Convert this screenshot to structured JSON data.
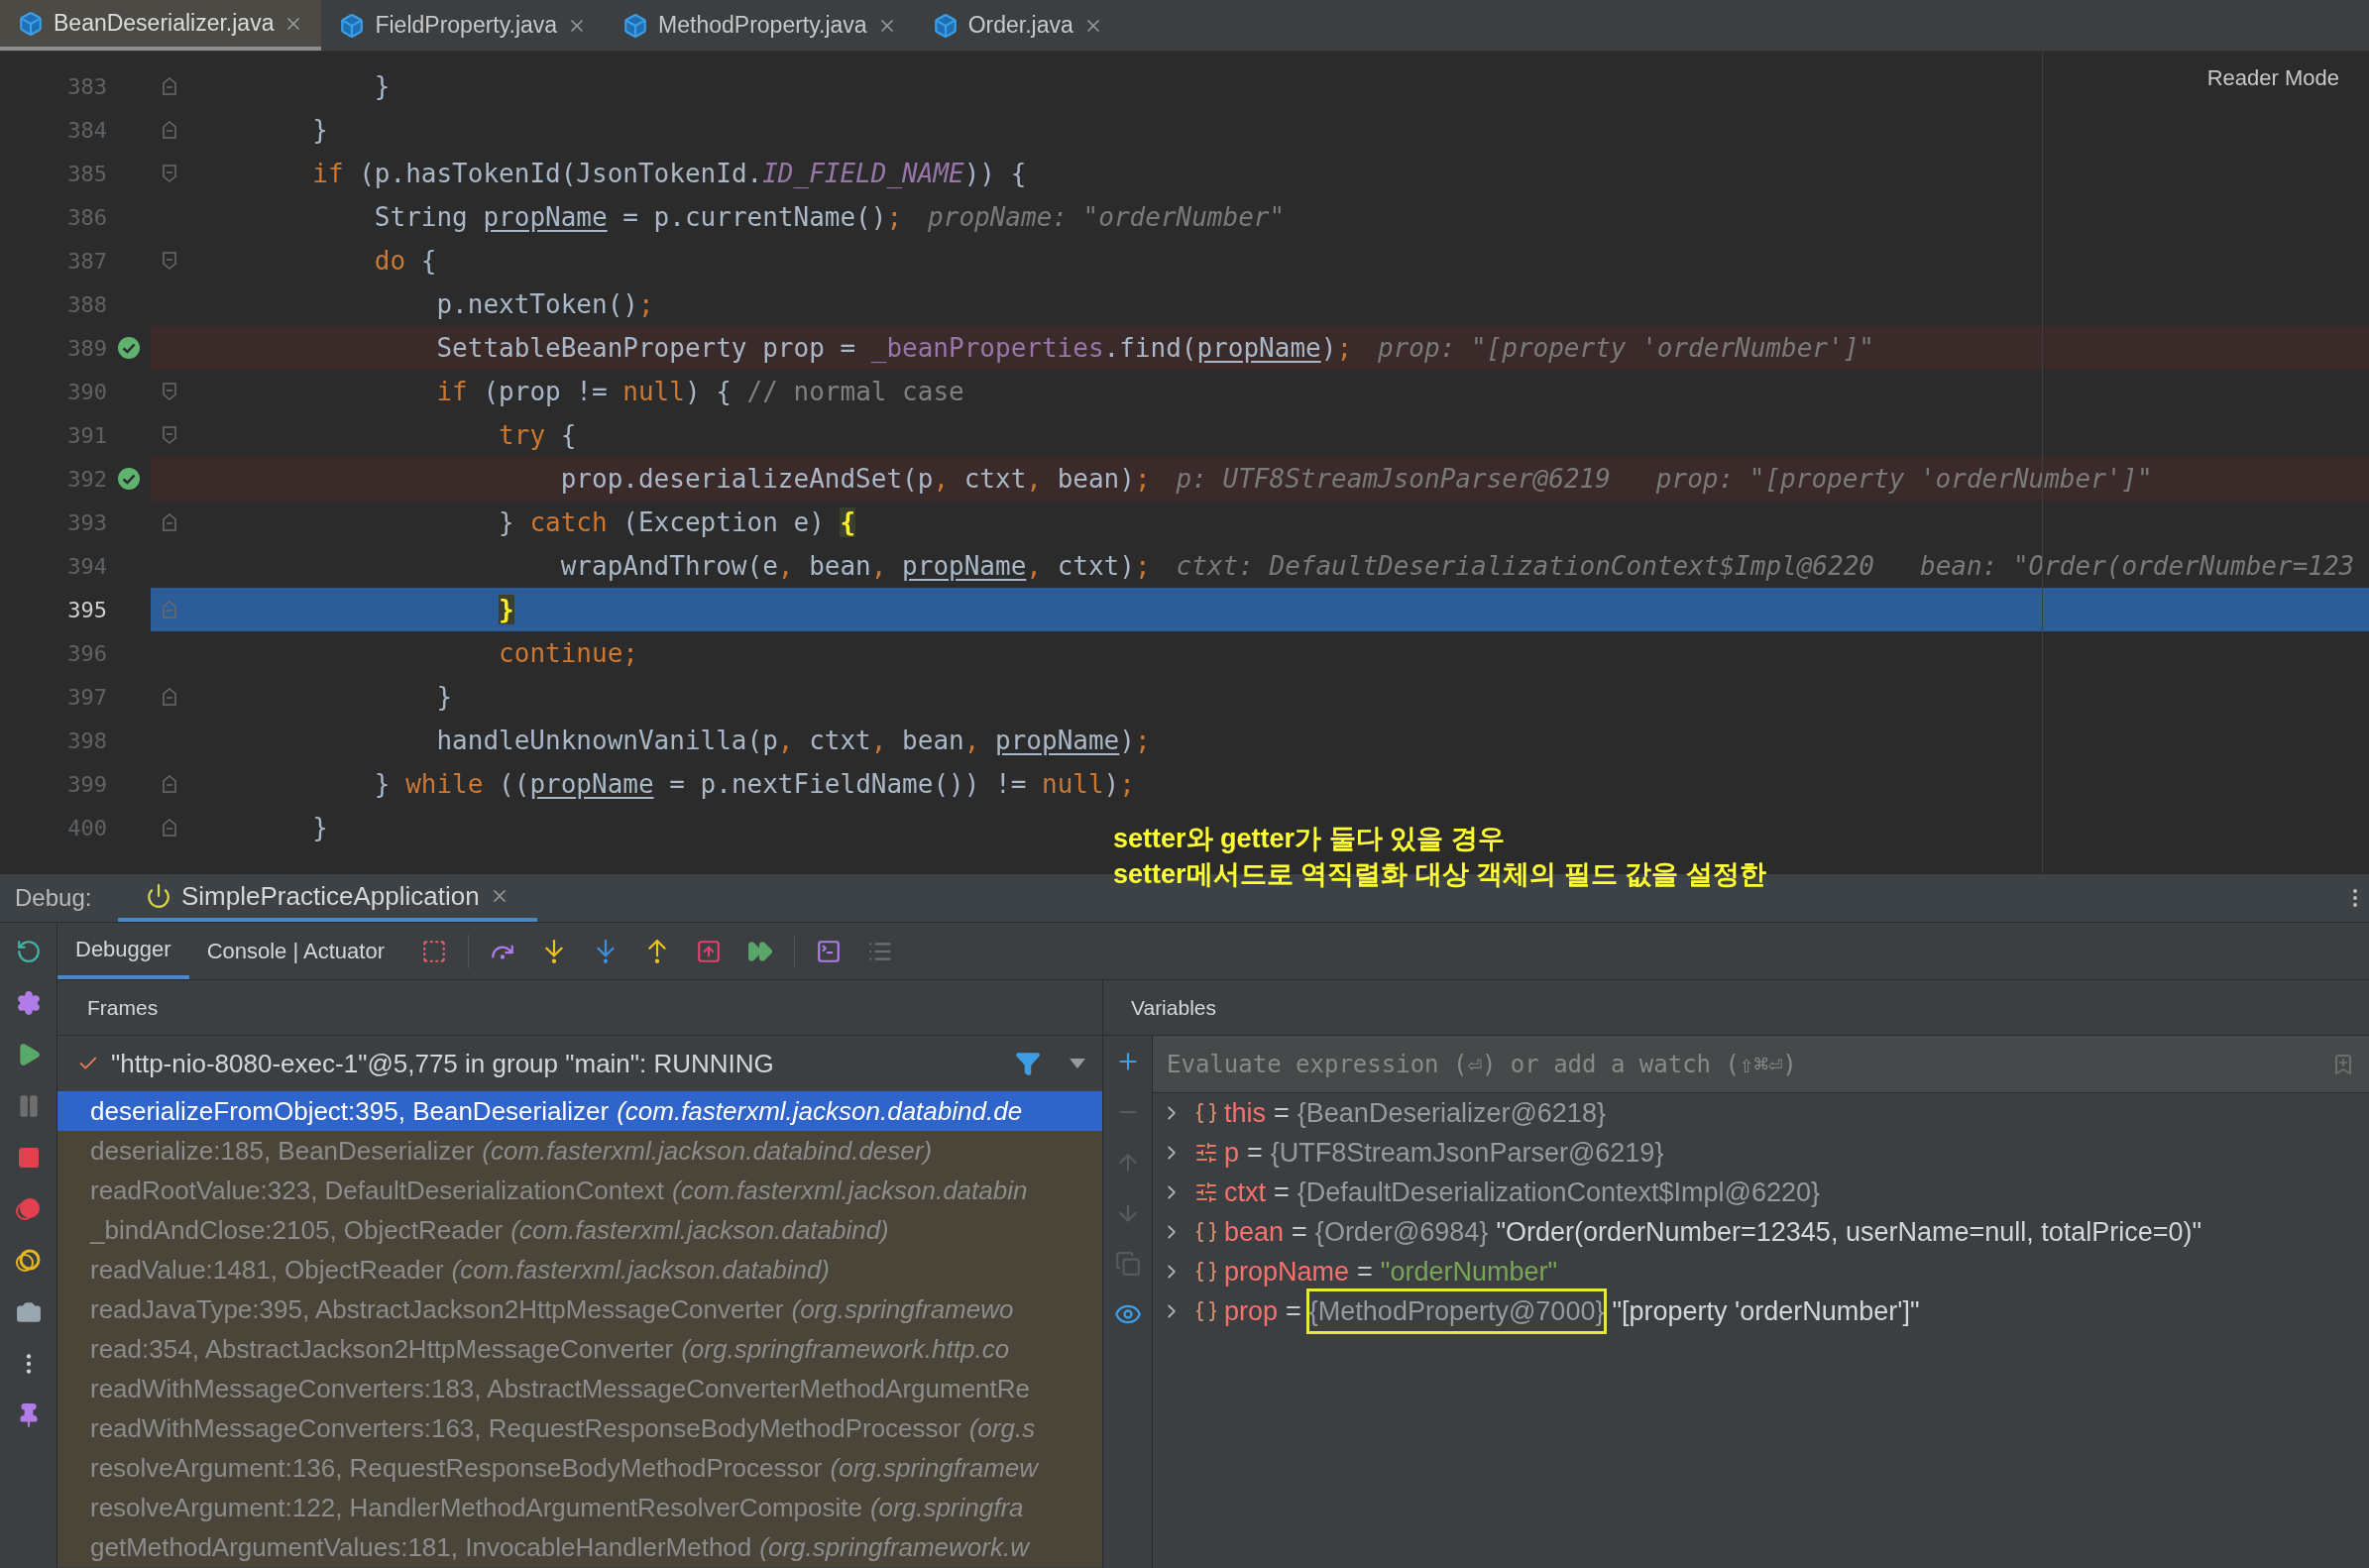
{
  "tabs": [
    {
      "label": "BeanDeserializer.java",
      "selected": true
    },
    {
      "label": "FieldProperty.java",
      "selected": false
    },
    {
      "label": "MethodProperty.java",
      "selected": false
    },
    {
      "label": "Order.java",
      "selected": false
    }
  ],
  "editor": {
    "reader_mode": "Reader Mode",
    "lines": [
      {
        "number": "383",
        "fold_open": false,
        "fold_close": true,
        "breakpoint": false,
        "current": false,
        "tokens": [
          {
            "text": "            }",
            "kind": "plain"
          }
        ]
      },
      {
        "number": "384",
        "fold_open": false,
        "fold_close": true,
        "breakpoint": false,
        "current": false,
        "tokens": [
          {
            "text": "        }",
            "kind": "plain"
          }
        ]
      },
      {
        "number": "385",
        "fold_open": true,
        "fold_close": false,
        "breakpoint": false,
        "current": false,
        "tokens": [
          {
            "text": "        if",
            "kind": "keyword"
          },
          {
            "text": " (p.hasTokenId(JsonTokenId.",
            "kind": "plain"
          },
          {
            "text": "ID_FIELD_NAME",
            "kind": "static"
          },
          {
            "text": ")) {",
            "kind": "plain"
          }
        ]
      },
      {
        "number": "386",
        "fold_open": false,
        "fold_close": false,
        "breakpoint": false,
        "current": false,
        "tokens": [
          {
            "text": "            String ",
            "kind": "plain"
          },
          {
            "text": "propName",
            "kind": "ref"
          },
          {
            "text": " = p.currentName()",
            "kind": "plain"
          },
          {
            "text": ";",
            "kind": "keyword"
          }
        ],
        "hints": [
          "propName: \"orderNumber\""
        ]
      },
      {
        "number": "387",
        "fold_open": true,
        "fold_close": false,
        "breakpoint": false,
        "current": false,
        "tokens": [
          {
            "text": "            do",
            "kind": "keyword"
          },
          {
            "text": " {",
            "kind": "plain"
          }
        ]
      },
      {
        "number": "388",
        "fold_open": false,
        "fold_close": false,
        "breakpoint": false,
        "current": false,
        "tokens": [
          {
            "text": "                p.nextToken()",
            "kind": "plain"
          },
          {
            "text": ";",
            "kind": "keyword"
          }
        ]
      },
      {
        "number": "389",
        "fold_open": false,
        "fold_close": false,
        "breakpoint": true,
        "current": false,
        "tokens": [
          {
            "text": "                SettableBeanProperty prop = ",
            "kind": "plain"
          },
          {
            "text": "_beanProperties",
            "kind": "field"
          },
          {
            "text": ".find(",
            "kind": "plain"
          },
          {
            "text": "propName",
            "kind": "ref"
          },
          {
            "text": ")",
            "kind": "plain"
          },
          {
            "text": ";",
            "kind": "keyword"
          }
        ],
        "hints": [
          "prop: \"[property 'orderNumber']\""
        ]
      },
      {
        "number": "390",
        "fold_open": true,
        "fold_close": false,
        "breakpoint": false,
        "current": false,
        "tokens": [
          {
            "text": "                if",
            "kind": "keyword"
          },
          {
            "text": " (prop != ",
            "kind": "plain"
          },
          {
            "text": "null",
            "kind": "keyword"
          },
          {
            "text": ") { ",
            "kind": "plain"
          },
          {
            "text": "// normal case",
            "kind": "comment"
          }
        ]
      },
      {
        "number": "391",
        "fold_open": true,
        "fold_close": false,
        "breakpoint": false,
        "current": false,
        "tokens": [
          {
            "text": "                    try",
            "kind": "keyword"
          },
          {
            "text": " {",
            "kind": "plain"
          }
        ]
      },
      {
        "number": "392",
        "fold_open": false,
        "fold_close": false,
        "breakpoint": true,
        "current": false,
        "tokens": [
          {
            "text": "                        prop.deserializeAndSet(p",
            "kind": "plain"
          },
          {
            "text": ",",
            "kind": "keyword"
          },
          {
            "text": " ctxt",
            "kind": "plain"
          },
          {
            "text": ",",
            "kind": "keyword"
          },
          {
            "text": " bean)",
            "kind": "plain"
          },
          {
            "text": ";",
            "kind": "keyword"
          }
        ],
        "hints": [
          "p: UTF8StreamJsonParser@6219",
          "prop: \"[property 'orderNumber']\""
        ]
      },
      {
        "number": "393",
        "fold_open": false,
        "fold_close": true,
        "breakpoint": false,
        "current": false,
        "tokens": [
          {
            "text": "                    } ",
            "kind": "plain"
          },
          {
            "text": "catch",
            "kind": "keyword"
          },
          {
            "text": " (Exception e) ",
            "kind": "plain"
          },
          {
            "text": "{",
            "kind": "match"
          }
        ]
      },
      {
        "number": "394",
        "fold_open": false,
        "fold_close": false,
        "breakpoint": false,
        "current": false,
        "tokens": [
          {
            "text": "                        wrapAndThrow(e",
            "kind": "plain"
          },
          {
            "text": ",",
            "kind": "keyword"
          },
          {
            "text": " bean",
            "kind": "plain"
          },
          {
            "text": ", ",
            "kind": "keyword"
          },
          {
            "text": "propName",
            "kind": "ref"
          },
          {
            "text": ",",
            "kind": "keyword"
          },
          {
            "text": " ctxt)",
            "kind": "plain"
          },
          {
            "text": ";",
            "kind": "keyword"
          }
        ],
        "hints": [
          "ctxt: DefaultDeserializationContext$Impl@6220",
          "bean: \"Order(orderNumber=123"
        ]
      },
      {
        "number": "395",
        "fold_open": false,
        "fold_close": true,
        "breakpoint": false,
        "current": true,
        "tokens": [
          {
            "text": "                    }",
            "kind": "match"
          }
        ]
      },
      {
        "number": "396",
        "fold_open": false,
        "fold_close": false,
        "breakpoint": false,
        "current": false,
        "tokens": [
          {
            "text": "                    continue;",
            "kind": "keyword"
          }
        ]
      },
      {
        "number": "397",
        "fold_open": false,
        "fold_close": true,
        "breakpoint": false,
        "current": false,
        "tokens": [
          {
            "text": "                }",
            "kind": "plain"
          }
        ]
      },
      {
        "number": "398",
        "fold_open": false,
        "fold_close": false,
        "breakpoint": false,
        "current": false,
        "tokens": [
          {
            "text": "                handleUnknownVanilla(p",
            "kind": "plain"
          },
          {
            "text": ",",
            "kind": "keyword"
          },
          {
            "text": " ctxt",
            "kind": "plain"
          },
          {
            "text": ",",
            "kind": "keyword"
          },
          {
            "text": " bean",
            "kind": "plain"
          },
          {
            "text": ", ",
            "kind": "keyword"
          },
          {
            "text": "propName",
            "kind": "ref"
          },
          {
            "text": ")",
            "kind": "plain"
          },
          {
            "text": ";",
            "kind": "keyword"
          }
        ]
      },
      {
        "number": "399",
        "fold_open": false,
        "fold_close": true,
        "breakpoint": false,
        "current": false,
        "tokens": [
          {
            "text": "            } ",
            "kind": "plain"
          },
          {
            "text": "while",
            "kind": "keyword"
          },
          {
            "text": " ((",
            "kind": "plain"
          },
          {
            "text": "propName",
            "kind": "ref"
          },
          {
            "text": " = p.nextFieldName()) != ",
            "kind": "plain"
          },
          {
            "text": "null",
            "kind": "keyword"
          },
          {
            "text": ")",
            "kind": "plain"
          },
          {
            "text": ";",
            "kind": "keyword"
          }
        ]
      },
      {
        "number": "400",
        "fold_open": false,
        "fold_close": true,
        "breakpoint": false,
        "current": false,
        "tokens": [
          {
            "text": "        }",
            "kind": "plain"
          }
        ]
      }
    ]
  },
  "annotation": [
    "setter와 getter가 둘다 있을 경우",
    "setter메서드로 역직렬화 대상 객체의 필드 값을 설정한"
  ],
  "debug": {
    "label": "Debug:",
    "session": {
      "label": "SimplePracticeApplication",
      "selected": true
    },
    "tabs": [
      {
        "label": "Debugger",
        "selected": true
      },
      {
        "label": "Console | Actuator",
        "selected": false
      }
    ],
    "frames": {
      "title": "Frames",
      "thread": "\"http-nio-8080-exec-1\"@5,775 in group \"main\": RUNNING",
      "items": [
        {
          "label": "deserializeFromObject:395, BeanDeserializer",
          "package": "(com.fasterxml.jackson.databind.de",
          "selected": true
        },
        {
          "label": "deserialize:185, BeanDeserializer",
          "package": "(com.fasterxml.jackson.databind.deser)",
          "selected": false,
          "library": true
        },
        {
          "label": "readRootValue:323, DefaultDeserializationContext",
          "package": "(com.fasterxml.jackson.databin",
          "selected": false,
          "library": true
        },
        {
          "label": "_bindAndClose:2105, ObjectReader",
          "package": "(com.fasterxml.jackson.databind)",
          "selected": false,
          "library": true
        },
        {
          "label": "readValue:1481, ObjectReader",
          "package": "(com.fasterxml.jackson.databind)",
          "selected": false,
          "library": true
        },
        {
          "label": "readJavaType:395, AbstractJackson2HttpMessageConverter",
          "package": "(org.springframewo",
          "selected": false,
          "library": true
        },
        {
          "label": "read:354, AbstractJackson2HttpMessageConverter",
          "package": "(org.springframework.http.co",
          "selected": false,
          "library": true
        },
        {
          "label": "readWithMessageConverters:183, AbstractMessageConverterMethodArgumentRe",
          "selected": false,
          "library": true
        },
        {
          "label": "readWithMessageConverters:163, RequestResponseBodyMethodProcessor",
          "package": "(org.s",
          "selected": false,
          "library": true
        },
        {
          "label": "resolveArgument:136, RequestResponseBodyMethodProcessor",
          "package": "(org.springframew",
          "selected": false,
          "library": true
        },
        {
          "label": "resolveArgument:122, HandlerMethodArgumentResolverComposite",
          "package": "(org.springfra",
          "selected": false,
          "library": true
        },
        {
          "label": "getMethodArgumentValues:181, InvocableHandlerMethod",
          "package": "(org.springframework.w",
          "selected": false,
          "library": true
        }
      ]
    },
    "variables": {
      "title": "Variables",
      "placeholder": "Evaluate expression (⏎) or add a watch (⇧⌘⏎)",
      "items": [
        {
          "name": "this",
          "kind": "object",
          "operator": "=",
          "value": "{BeanDeserializer@6218}",
          "is_string": false,
          "highlighted": false
        },
        {
          "name": "p",
          "kind": "field",
          "operator": "=",
          "value": "{UTF8StreamJsonParser@6219}",
          "is_string": false,
          "highlighted": false
        },
        {
          "name": "ctxt",
          "kind": "field",
          "operator": "=",
          "value": "{DefaultDeserializationContext$Impl@6220}",
          "is_string": false,
          "highlighted": false
        },
        {
          "name": "bean",
          "kind": "object",
          "operator": "=",
          "value": "{Order@6984}",
          "is_string": false,
          "detail": "\"Order(orderNumber=12345, userName=null, totalPrice=0)\"",
          "highlighted": false
        },
        {
          "name": "propName",
          "kind": "object",
          "operator": "=",
          "value": "\"orderNumber\"",
          "is_string": true,
          "highlighted": false
        },
        {
          "name": "prop",
          "kind": "object",
          "operator": "=",
          "value": "{MethodProperty@7000}",
          "is_string": false,
          "detail": "\"[property 'orderNumber']\"",
          "highlighted": true
        }
      ]
    }
  }
}
